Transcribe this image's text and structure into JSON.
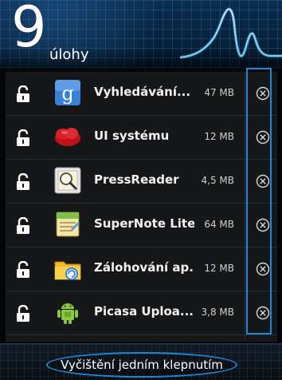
{
  "header": {
    "task_count": "9",
    "label": "úlohy"
  },
  "tasks": [
    {
      "name": "Vyhledávání...",
      "size": "47 MB",
      "icon": "google-search-icon",
      "locked": true
    },
    {
      "name": "UI systému",
      "size": "12 MB",
      "icon": "red-cloud-icon",
      "locked": true
    },
    {
      "name": "PressReader",
      "size": "4,5 MB",
      "icon": "pressreader-icon",
      "locked": true
    },
    {
      "name": "SuperNote Lite",
      "size": "64 MB",
      "icon": "supernote-icon",
      "locked": true
    },
    {
      "name": "Zálohování ap...",
      "size": "12 MB",
      "icon": "backup-folder-icon",
      "locked": true
    },
    {
      "name": "Picasa Uploa...",
      "size": "3,8 MB",
      "icon": "android-icon",
      "locked": true
    }
  ],
  "footer": {
    "clear_all_label": "Vyčištění jedním klepnutím"
  },
  "colors": {
    "accent": "#1e88d6",
    "header_bg": "#08223d",
    "list_bg": "#161718"
  }
}
